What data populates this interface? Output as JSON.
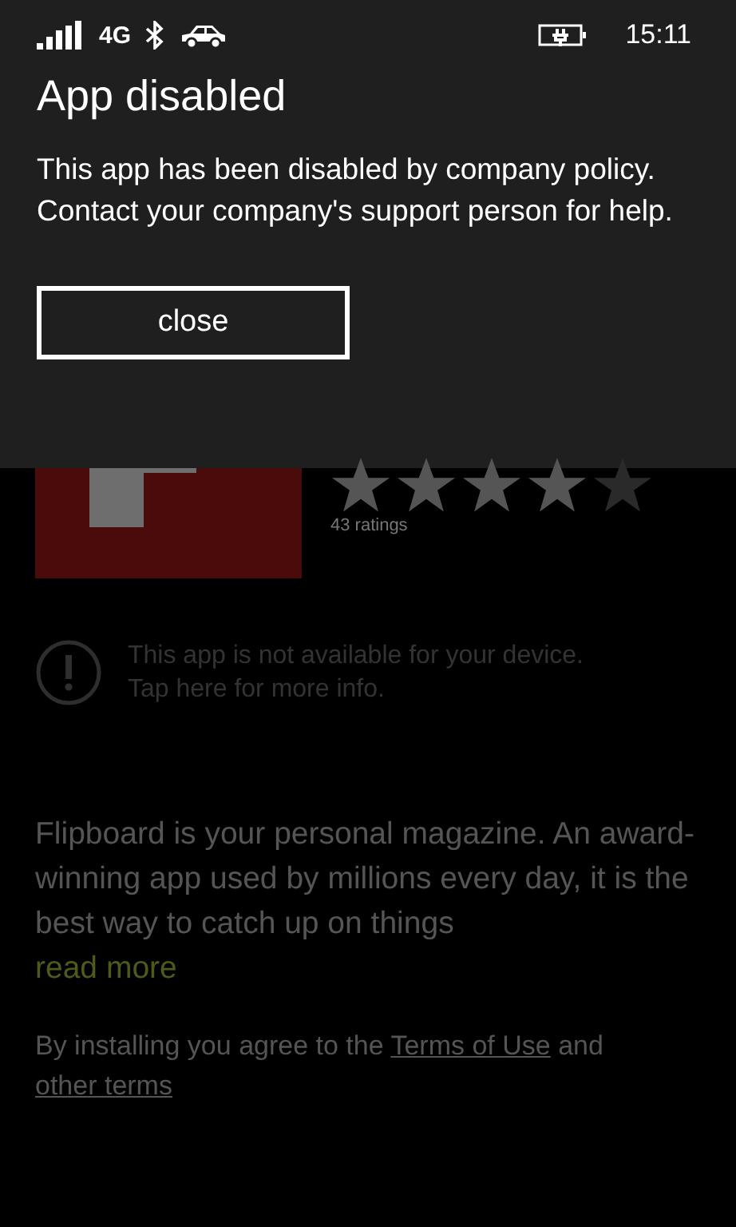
{
  "status_bar": {
    "network": "4G",
    "time": "15:11"
  },
  "dialog": {
    "title": "App disabled",
    "message": "This app has been disabled by company policy. Contact your company's support person for help.",
    "button": "close"
  },
  "app": {
    "stars": 4,
    "ratings": "43 ratings"
  },
  "notice": {
    "lines": [
      "This app is not available for your device.",
      "Tap here for more info."
    ]
  },
  "description": {
    "text": "Flipboard is your personal magazine. An award-winning app used by millions every day, it is the best way to catch up on things",
    "read_more": "read more"
  },
  "terms": {
    "before": "By installing you agree to the",
    "link1": "Terms of Use",
    "middle": "and",
    "link2": "other terms"
  }
}
